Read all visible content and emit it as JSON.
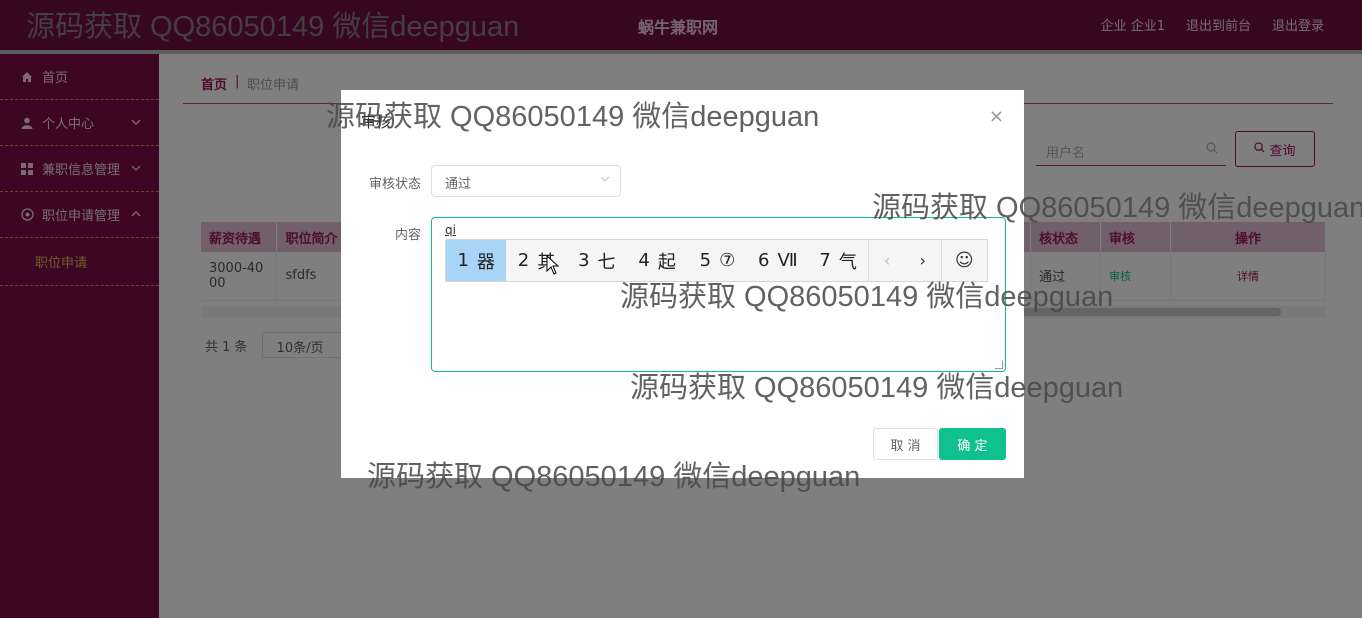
{
  "header": {
    "brand": "蜗牛兼职网",
    "links": [
      "企业 企业1",
      "退出到前台",
      "退出登录"
    ]
  },
  "sidebar": {
    "items": [
      {
        "label": "首页",
        "icon": "home-icon"
      },
      {
        "label": "个人中心",
        "icon": "user-icon",
        "chevron": "down"
      },
      {
        "label": "兼职信息管理",
        "icon": "grid-icon",
        "chevron": "down"
      },
      {
        "label": "职位申请管理",
        "icon": "globe-icon",
        "chevron": "up"
      }
    ],
    "sub_item": "职位申请"
  },
  "breadcrumb": {
    "home": "首页",
    "separator": "|",
    "current": "职位申请"
  },
  "search": {
    "placeholder": "用户名",
    "button": "查询"
  },
  "table": {
    "headers": [
      "薪资待遇",
      "职位简介",
      "核状态",
      "审核",
      "操作"
    ],
    "row": {
      "salary": "3000-4000",
      "intro": "sfdfs",
      "status": "通过",
      "review": "审核",
      "detail": "详情"
    }
  },
  "pager": {
    "total": "共 1 条",
    "page_size": "10条/页"
  },
  "dialog": {
    "title": "审核",
    "close": "×",
    "status_label": "审核状态",
    "status_value": "通过",
    "content_label": "内容",
    "content_typed": "qi",
    "cancel": "取 消",
    "confirm": "确 定"
  },
  "ime": {
    "candidates": [
      {
        "num": "1",
        "text": "器"
      },
      {
        "num": "2",
        "text": "其"
      },
      {
        "num": "3",
        "text": "七"
      },
      {
        "num": "4",
        "text": "起"
      },
      {
        "num": "5",
        "text": "⑦"
      },
      {
        "num": "6",
        "text": "Ⅶ"
      },
      {
        "num": "7",
        "text": "气"
      }
    ],
    "prev": "‹",
    "next": "›",
    "emoji": "☺"
  },
  "watermark": "源码获取 QQ86050149 微信deepguan",
  "colors": {
    "topbar": "#6e0f45",
    "sidebar": "#7a0d4b",
    "accent": "#a0115a",
    "confirm": "#10c08f"
  }
}
